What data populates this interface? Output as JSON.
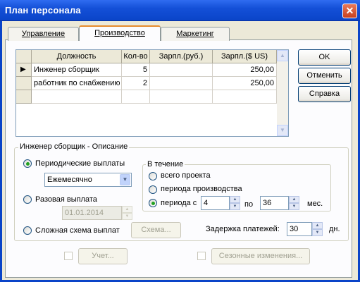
{
  "window": {
    "title": "План персонала",
    "close": "✕"
  },
  "tabs": [
    {
      "label": "Управление"
    },
    {
      "label": "Производство"
    },
    {
      "label": "Маркетинг"
    }
  ],
  "grid": {
    "columns": [
      "Должность",
      "Кол-во",
      "Зарпл.(руб.)",
      "Зарпл.($ US)"
    ],
    "rows": [
      {
        "position": "Инженер сборщик",
        "qty": "5",
        "rub": "",
        "usd": "250,00"
      },
      {
        "position": "работник по снабжению",
        "qty": "2",
        "rub": "",
        "usd": "250,00"
      }
    ],
    "current_marker": "▶"
  },
  "buttons": {
    "ok": "OK",
    "cancel": "Отменить",
    "help": "Справка",
    "scheme": "Схема...",
    "account": "Учет...",
    "seasonal": "Сезонные изменения..."
  },
  "description": {
    "group_title": "Инженер сборщик - Описание",
    "periodic_label": "Периодические выплаты",
    "periodic_value": "Ежемесячно",
    "single_label": "Разовая выплата",
    "single_date": "01.01.2014",
    "complex_label": "Сложная схема выплат",
    "during": {
      "title": "В течение",
      "whole": "всего проекта",
      "production": "периода производства",
      "period_from": "периода с",
      "from_value": "4",
      "to_label": "по",
      "to_value": "36",
      "unit": "мес."
    },
    "delay_label": "Задержка платежей:",
    "delay_value": "30",
    "delay_unit": "дн."
  }
}
